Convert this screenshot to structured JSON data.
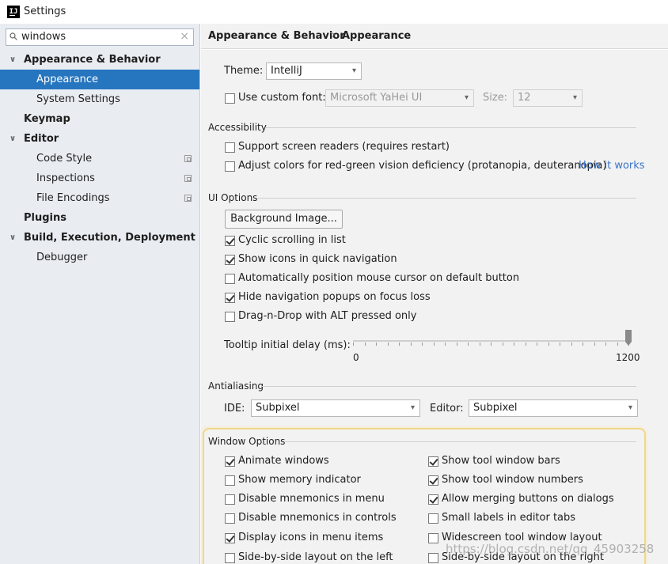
{
  "window": {
    "title": "Settings",
    "logo_text": "IJ"
  },
  "search": {
    "value": "windows",
    "clear_symbol": "×"
  },
  "sidebar": {
    "items": [
      {
        "label": "Appearance & Behavior",
        "arrow": "∨"
      },
      {
        "label": "Appearance"
      },
      {
        "label": "System Settings"
      },
      {
        "label": "Keymap"
      },
      {
        "label": "Editor",
        "arrow": "∨"
      },
      {
        "label": "Code Style"
      },
      {
        "label": "Inspections"
      },
      {
        "label": "File Encodings"
      },
      {
        "label": "Plugins"
      },
      {
        "label": "Build, Execution, Deployment",
        "arrow": "∨"
      },
      {
        "label": "Debugger"
      }
    ]
  },
  "breadcrumb": {
    "part1": "Appearance & Behavior",
    "separator": "›",
    "part2": "Appearance"
  },
  "theme": {
    "label": "Theme:",
    "value": "IntelliJ"
  },
  "font": {
    "label": "Use custom font:",
    "value": "Microsoft YaHei UI",
    "size_label": "Size:",
    "size_value": "12"
  },
  "accessibility": {
    "title": "Accessibility",
    "screen_readers": "Support screen readers (requires restart)",
    "adjust_colors": "Adjust colors for red-green vision deficiency (protanopia, deuteranopia)",
    "how_it_works": "How it works"
  },
  "ui_options": {
    "title": "UI Options",
    "background_image": "Background Image...",
    "cyclic_scrolling": "Cyclic scrolling in list",
    "show_icons_quick_nav": "Show icons in quick navigation",
    "auto_position_mouse": "Automatically position mouse cursor on default button",
    "hide_nav_popups": "Hide navigation popups on focus loss",
    "drag_n_drop": "Drag-n-Drop with ALT pressed only",
    "tooltip_label": "Tooltip initial delay (ms):",
    "tooltip_min": "0",
    "tooltip_max": "1200",
    "tooltip_value": 1200
  },
  "antialiasing": {
    "title": "Antialiasing",
    "ide_label": "IDE:",
    "ide_value": "Subpixel",
    "editor_label": "Editor:",
    "editor_value": "Subpixel"
  },
  "window_options": {
    "title": "Window Options",
    "animate_windows": "Animate windows",
    "show_memory": "Show memory indicator",
    "disable_mnemonics_menu": "Disable mnemonics in menu",
    "disable_mnemonics_controls": "Disable mnemonics in controls",
    "display_icons_menu": "Display icons in menu items",
    "side_by_side_left": "Side-by-side layout on the left",
    "show_tool_window_bars": "Show tool window bars",
    "show_tool_window_numbers": "Show tool window numbers",
    "allow_merging_buttons": "Allow merging buttons on dialogs",
    "small_labels": "Small labels in editor tabs",
    "widescreen_layout": "Widescreen tool window layout",
    "side_by_side_right": "Side-by-side layout on the right"
  },
  "watermark": "https://blog.csdn.net/qq_45903258",
  "colors": {
    "selection": "#2675bf",
    "link": "#3a73c6",
    "highlight_border": "#f0d78a"
  }
}
